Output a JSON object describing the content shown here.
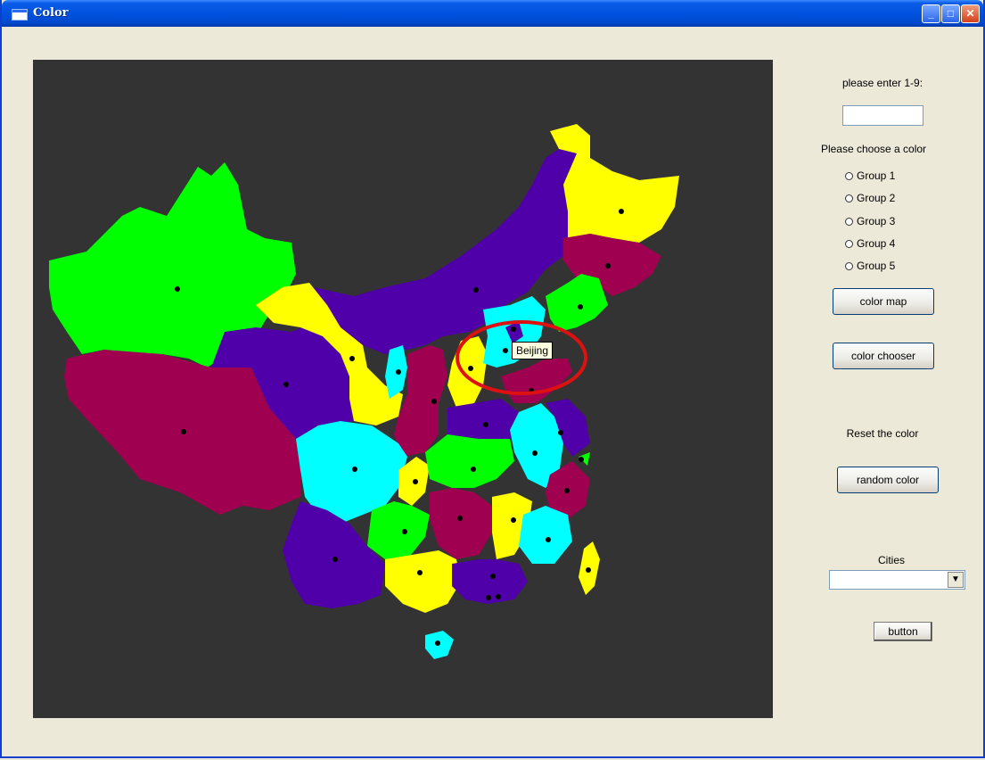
{
  "window": {
    "title": "Color",
    "controls": {
      "minimize": "_",
      "maximize": "□",
      "close": "✕"
    }
  },
  "map": {
    "tooltip": "Beijing",
    "highlight_color": "#dd1111",
    "region_colors": {
      "group_a": "#00ff00",
      "group_b": "#a00050",
      "group_c": "#5000a8",
      "group_d": "#ffff00",
      "group_e": "#00ffff"
    }
  },
  "controls": {
    "enter_label": "please enter 1-9:",
    "enter_value": "",
    "choose_label": "Please choose a color",
    "radio_groups": [
      "Group 1",
      "Group 2",
      "Group 3",
      "Group 4",
      "Group 5"
    ],
    "color_map_button": "color map",
    "color_chooser_button": "color chooser",
    "reset_label": "Reset the color",
    "random_color_button": "random color",
    "cities_label": "Cities",
    "cities_selected": "",
    "cities_arrow": "▼",
    "generic_button": "button"
  }
}
